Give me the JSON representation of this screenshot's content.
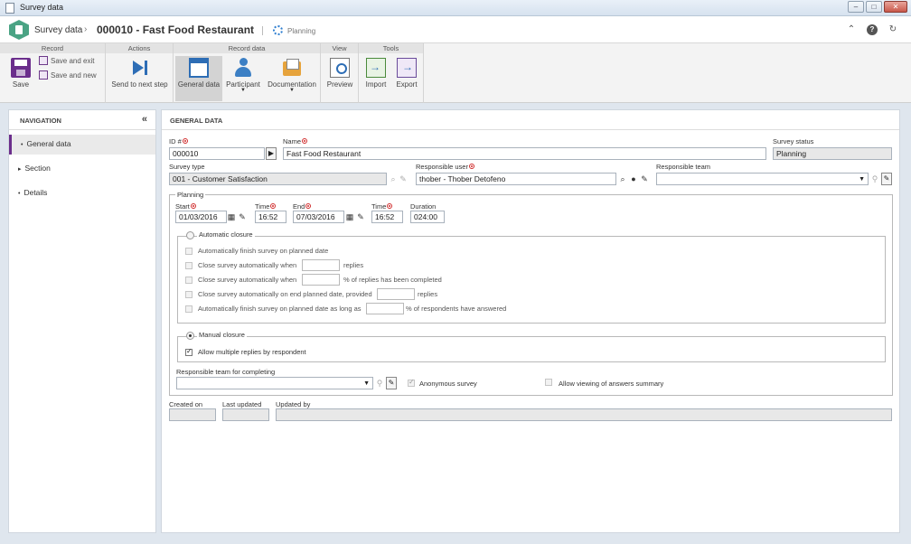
{
  "window": {
    "title": "Survey data"
  },
  "header": {
    "breadcrumb_root": "Survey data",
    "breadcrumb_sep": "›",
    "record_title": "000010 - Fast Food Restaurant",
    "step_label": "Planning"
  },
  "ribbon": {
    "groups": {
      "record": "Record",
      "actions": "Actions",
      "record_data": "Record data",
      "view": "View",
      "tools": "Tools"
    },
    "save": "Save",
    "save_and_exit": "Save and exit",
    "save_and_new": "Save and new",
    "send_to_next_step": "Send to next step",
    "general_data": "General data",
    "participant": "Participant",
    "documentation": "Documentation",
    "preview": "Preview",
    "import": "Import",
    "export": "Export"
  },
  "navigation": {
    "title": "NAVIGATION",
    "items": [
      {
        "label": "General data",
        "active": true
      },
      {
        "label": "Section",
        "active": false
      },
      {
        "label": "Details",
        "active": false
      }
    ]
  },
  "general": {
    "title": "GENERAL DATA",
    "id_label": "ID #",
    "id_value": "000010",
    "name_label": "Name",
    "name_value": "Fast Food Restaurant",
    "status_label": "Survey status",
    "status_value": "Planning",
    "type_label": "Survey type",
    "type_value": "001 - Customer Satisfaction",
    "resp_user_label": "Responsible user",
    "resp_user_value": "thober - Thober Detofeno",
    "resp_team_label": "Responsible team",
    "resp_team_value": ""
  },
  "planning": {
    "legend": "Planning",
    "start_label": "Start",
    "start_value": "01/03/2016",
    "time1_label": "Time",
    "time1_value": "16:52",
    "end_label": "End",
    "end_value": "07/03/2016",
    "time2_label": "Time",
    "time2_value": "16:52",
    "duration_label": "Duration",
    "duration_value": "024:00",
    "auto_closure": {
      "legend": "Automatic closure",
      "opt1": "Automatically finish survey on planned date",
      "opt2_pre": "Close survey automatically when",
      "opt2_post": "replies",
      "opt3_pre": "Close survey automatically when",
      "opt3_post": "% of replies has been completed",
      "opt4_pre": "Close survey automatically on end planned date, provided",
      "opt4_post": "replies",
      "opt5_pre": "Automatically finish survey on planned date as long as",
      "opt5_post": "% of respondents have answered"
    },
    "manual_closure": {
      "legend": "Manual closure",
      "allow_multiple": "Allow multiple replies by respondent"
    },
    "resp_team_completing_label": "Responsible team for completing",
    "anonymous_label": "Anonymous survey",
    "allow_viewing_label": "Allow viewing of answers summary"
  },
  "footer": {
    "created_on": "Created on",
    "last_updated": "Last updated",
    "updated_by": "Updated by"
  }
}
